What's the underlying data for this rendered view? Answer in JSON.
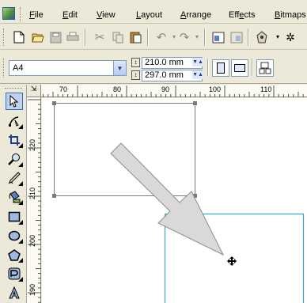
{
  "menu": {
    "items": [
      {
        "label": "File",
        "mnemonic": "F",
        "rest": "ile"
      },
      {
        "label": "Edit",
        "mnemonic": "E",
        "rest": "dit"
      },
      {
        "label": "View",
        "mnemonic": "V",
        "rest": "iew"
      },
      {
        "label": "Layout",
        "mnemonic": "L",
        "rest": "ayout"
      },
      {
        "label": "Arrange",
        "mnemonic": "A",
        "rest": "rrange"
      },
      {
        "label": "Effects",
        "pre": "Eff",
        "mnemonic": "e",
        "rest": "cts"
      },
      {
        "label": "Bitmaps",
        "mnemonic": "B",
        "rest": "itmaps"
      }
    ]
  },
  "toolbar": {
    "icons": [
      "new-icon",
      "open-icon",
      "save-icon",
      "print-icon",
      "cut-icon",
      "copy-icon",
      "paste-icon",
      "undo-icon",
      "redo-icon",
      "import-icon",
      "export-icon",
      "application-launcher-icon"
    ]
  },
  "property_bar": {
    "page_size": "A4",
    "width": "210.0 mm",
    "height": "297.0 mm"
  },
  "ruler": {
    "horizontal_labels": [
      "70",
      "80",
      "90",
      "100",
      "110"
    ],
    "vertical_labels": [
      "220",
      "210",
      "200",
      "190"
    ]
  },
  "toolbox": {
    "tools": [
      "pick-tool-icon",
      "shape-tool-icon",
      "crop-tool-icon",
      "zoom-tool-icon",
      "freehand-tool-icon",
      "smart-fill-tool-icon",
      "rectangle-tool-icon",
      "ellipse-tool-icon",
      "polygon-tool-icon",
      "basic-shapes-tool-icon",
      "text-tool-icon"
    ]
  },
  "colors": {
    "selection_outline": "#7a7a7a",
    "page_border": "#3aa3c9",
    "arrow_fill": "#d9d9d9",
    "arrow_stroke": "#8c8c8c",
    "active_tool": "#c1d2ee"
  }
}
